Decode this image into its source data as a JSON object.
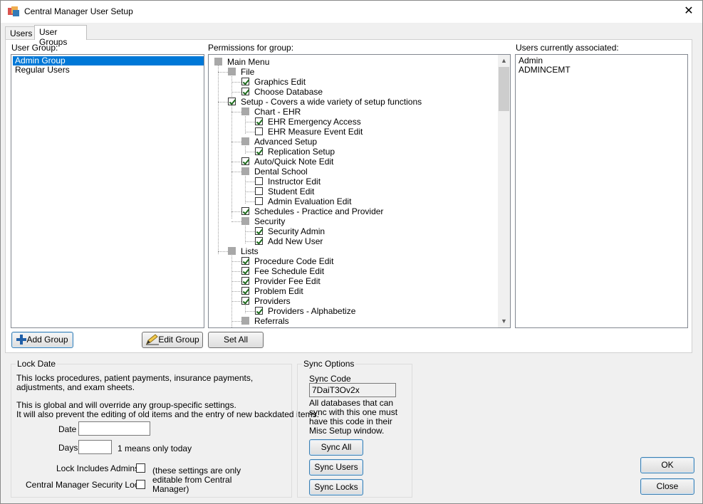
{
  "window": {
    "title": "Central Manager User Setup"
  },
  "tabs": [
    {
      "label": "Users"
    },
    {
      "label": "User Groups"
    }
  ],
  "user_group": {
    "label": "User Group:",
    "items": [
      {
        "name": "Admin Group"
      },
      {
        "name": "Regular Users"
      }
    ]
  },
  "permissions": {
    "label": "Permissions for group:",
    "tree": [
      {
        "label": "Main Menu",
        "level": 0,
        "kind": "square",
        "checked": false
      },
      {
        "label": "File",
        "level": 1,
        "kind": "square",
        "checked": false
      },
      {
        "label": "Graphics Edit",
        "level": 2,
        "kind": "checkbox",
        "checked": true
      },
      {
        "label": "Choose Database",
        "level": 2,
        "kind": "checkbox",
        "checked": true
      },
      {
        "label": "Setup - Covers a wide variety of setup functions",
        "level": 1,
        "kind": "checkbox",
        "checked": true
      },
      {
        "label": "Chart - EHR",
        "level": 2,
        "kind": "square",
        "checked": false
      },
      {
        "label": "EHR Emergency Access",
        "level": 3,
        "kind": "checkbox",
        "checked": true
      },
      {
        "label": "EHR Measure Event Edit",
        "level": 3,
        "kind": "checkbox",
        "checked": false
      },
      {
        "label": "Advanced Setup",
        "level": 2,
        "kind": "square",
        "checked": false
      },
      {
        "label": "Replication Setup",
        "level": 3,
        "kind": "checkbox",
        "checked": true
      },
      {
        "label": "Auto/Quick Note Edit",
        "level": 2,
        "kind": "checkbox",
        "checked": true
      },
      {
        "label": "Dental School",
        "level": 2,
        "kind": "square",
        "checked": false
      },
      {
        "label": "Instructor Edit",
        "level": 3,
        "kind": "checkbox",
        "checked": false
      },
      {
        "label": "Student Edit",
        "level": 3,
        "kind": "checkbox",
        "checked": false
      },
      {
        "label": "Admin Evaluation Edit",
        "level": 3,
        "kind": "checkbox",
        "checked": false
      },
      {
        "label": "Schedules - Practice and Provider",
        "level": 2,
        "kind": "checkbox",
        "checked": true
      },
      {
        "label": "Security",
        "level": 2,
        "kind": "square",
        "checked": false
      },
      {
        "label": "Security Admin",
        "level": 3,
        "kind": "checkbox",
        "checked": true
      },
      {
        "label": "Add New User",
        "level": 3,
        "kind": "checkbox",
        "checked": true
      },
      {
        "label": "Lists",
        "level": 1,
        "kind": "square",
        "checked": false
      },
      {
        "label": "Procedure Code Edit",
        "level": 2,
        "kind": "checkbox",
        "checked": true
      },
      {
        "label": "Fee Schedule Edit",
        "level": 2,
        "kind": "checkbox",
        "checked": true
      },
      {
        "label": "Provider Fee Edit",
        "level": 2,
        "kind": "checkbox",
        "checked": true
      },
      {
        "label": "Problem Edit",
        "level": 2,
        "kind": "checkbox",
        "checked": true
      },
      {
        "label": "Providers",
        "level": 2,
        "kind": "checkbox",
        "checked": true
      },
      {
        "label": "Providers - Alphabetize",
        "level": 3,
        "kind": "checkbox",
        "checked": true
      },
      {
        "label": "Referrals",
        "level": 2,
        "kind": "square",
        "checked": false
      }
    ]
  },
  "users_associated": {
    "label": "Users currently associated:",
    "items": [
      {
        "name": "Admin"
      },
      {
        "name": "ADMINCEMT"
      }
    ]
  },
  "buttons": {
    "add_group": "Add Group",
    "edit_group": "Edit Group",
    "set_all": "Set All",
    "sync_all": "Sync All",
    "sync_users": "Sync Users",
    "sync_locks": "Sync Locks",
    "ok": "OK",
    "close": "Close"
  },
  "lock_date": {
    "title": "Lock Date",
    "desc1": "This locks procedures, patient payments, insurance payments, adjustments, and exam sheets.",
    "desc2": "This is global and will override any group-specific settings.",
    "desc3": "It will also prevent the editing of old items and the entry of new backdated items.",
    "date_label": "Date",
    "date_value": "",
    "days_label": "Days",
    "days_value": "",
    "days_hint": "1 means only today",
    "lock_admins_label": "Lock Includes Admins",
    "security_lock_label": "Central Manager Security Lock",
    "editable_note": "(these settings are only editable from Central Manager)"
  },
  "sync_options": {
    "title": "Sync Options",
    "code_label": "Sync Code",
    "code_value": "7DaiT3Ov2x",
    "desc": "All databases that can sync with this one must have this code in their Misc Setup window."
  }
}
